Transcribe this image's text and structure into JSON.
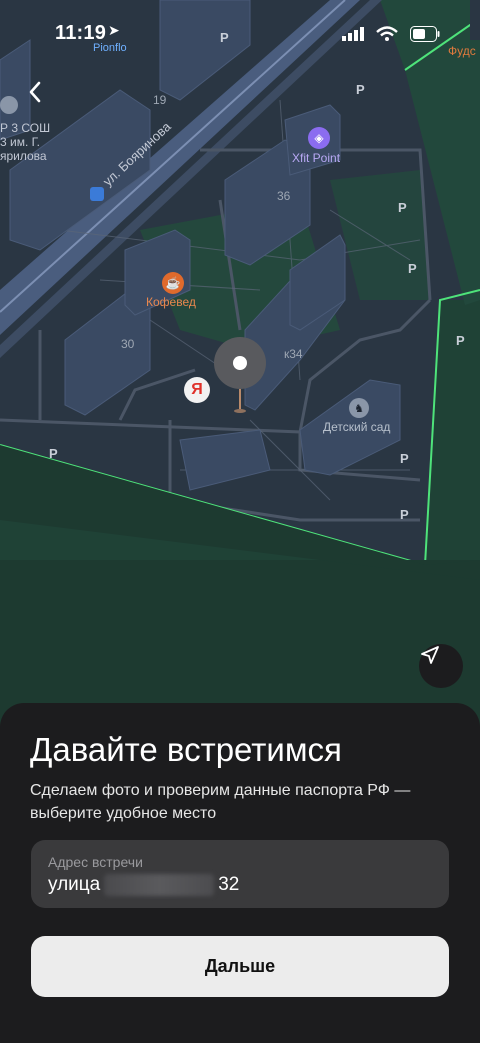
{
  "status": {
    "time": "11:19",
    "sub_app": "Pionflo"
  },
  "map": {
    "street": "ул. Бояринова",
    "labels": {
      "n19": "19",
      "n36": "36",
      "n30": "30",
      "k34": "к34",
      "school_1": "Р 3 СОШ",
      "school_2": "3 им. Г.",
      "school_3": "ярилова",
      "fud": "Фудс",
      "p": "P"
    },
    "poi": {
      "xfit": "Xfit Point",
      "cafe": "Кофевед",
      "kindergarten": "Детский сад",
      "yandex_letter": "Я"
    },
    "colors": {
      "zone": "#4ee37a",
      "poi_purple": "#8b6cf0",
      "poi_orange": "#e06a2c",
      "yandex_red": "#e0312a"
    }
  },
  "sheet": {
    "title": "Давайте встретимся",
    "subtitle": "Сделаем фото и проверим данные паспорта РФ — выберите удобное место",
    "address_label": "Адрес встречи",
    "address_prefix": "улица",
    "address_suffix": "32",
    "next_label": "Дальше"
  }
}
